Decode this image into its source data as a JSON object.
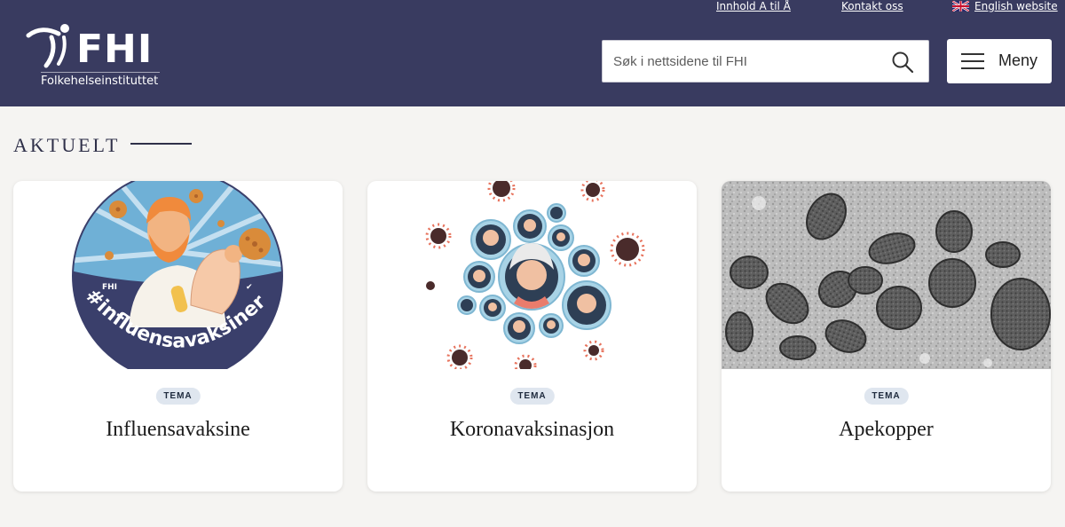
{
  "header": {
    "logo_text": "FHI",
    "logo_sub": "Folkehelseinstituttet",
    "links": {
      "az": "Innhold A til Å",
      "contact": "Kontakt oss",
      "english": "English website"
    },
    "search_placeholder": "Søk i nettsidene til FHI",
    "menu_label": "Meny"
  },
  "section": {
    "title": "AKTUELT"
  },
  "cards": [
    {
      "tag": "TEMA",
      "title": "Influensavaksine",
      "badge_text": "#influensavaksinert",
      "badge_logo": "FHI"
    },
    {
      "tag": "TEMA",
      "title": "Koronavaksinasjon"
    },
    {
      "tag": "TEMA",
      "title": "Apekopper"
    }
  ],
  "colors": {
    "header_bg": "#393b60",
    "page_bg": "#f5f4f2",
    "tag_bg": "#dfe6ef",
    "badge_navy": "#3a3f6b",
    "badge_sky": "#6fb0d6",
    "virus_orange": "#d98b3a"
  },
  "icons": {
    "search": "search-icon",
    "menu": "hamburger-icon",
    "flag": "uk-flag-icon"
  }
}
